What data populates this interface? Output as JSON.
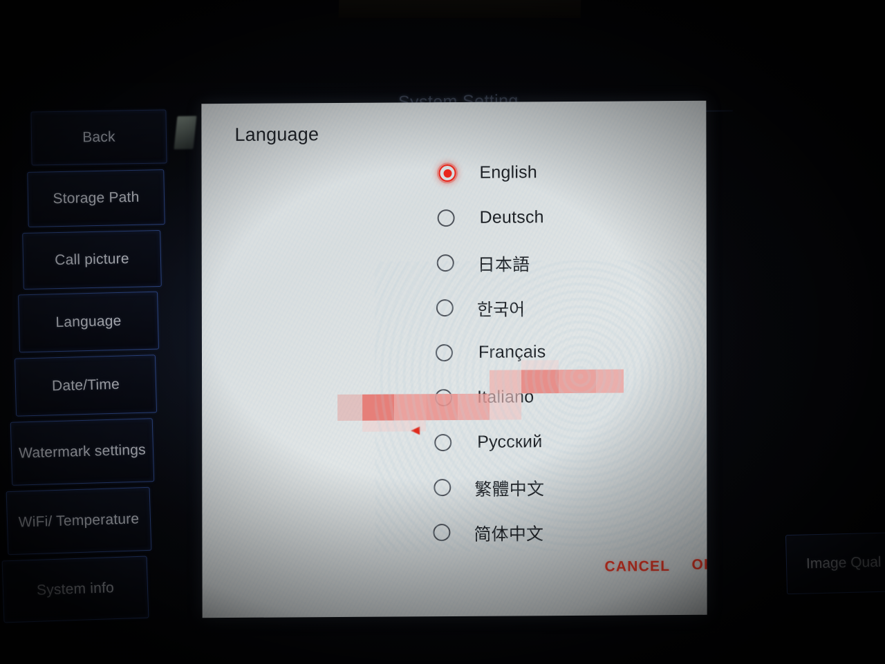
{
  "page": {
    "background_title": "System Setting"
  },
  "sidebar": {
    "items": [
      {
        "label": "Back",
        "name": "back"
      },
      {
        "label": "Storage Path",
        "name": "storage-path"
      },
      {
        "label": "Call picture",
        "name": "call-picture"
      },
      {
        "label": "Language",
        "name": "language"
      },
      {
        "label": "Date/Time",
        "name": "date-time"
      },
      {
        "label": "Watermark settings",
        "name": "watermark-settings"
      },
      {
        "label": "WiFi/ Temperature",
        "name": "wifi-temperature"
      },
      {
        "label": "System info",
        "name": "system-info"
      }
    ]
  },
  "right_panel": {
    "image_quality_label": "Image Qual"
  },
  "dialog": {
    "title": "Language",
    "options": [
      {
        "label": "English",
        "selected": true
      },
      {
        "label": "Deutsch",
        "selected": false
      },
      {
        "label": "日本語",
        "selected": false
      },
      {
        "label": "한국어",
        "selected": false
      },
      {
        "label": "Français",
        "selected": false
      },
      {
        "label": "Italiano",
        "selected": false
      },
      {
        "label": "Русский",
        "selected": false
      },
      {
        "label": "繁體中文",
        "selected": false
      },
      {
        "label": "简体中文",
        "selected": false
      }
    ],
    "cancel_label": "CANCEL",
    "ok_label": "OK"
  },
  "colors": {
    "accent_red": "#e8271c",
    "action_red": "#ef3b28",
    "dialog_bg": "#dee3e4",
    "nav_border_blue": "#3e60b4",
    "nav_text": "#c9ccd4"
  },
  "annotation": {
    "type": "mosaic-censored-red-marking",
    "points_at": "Русский"
  }
}
